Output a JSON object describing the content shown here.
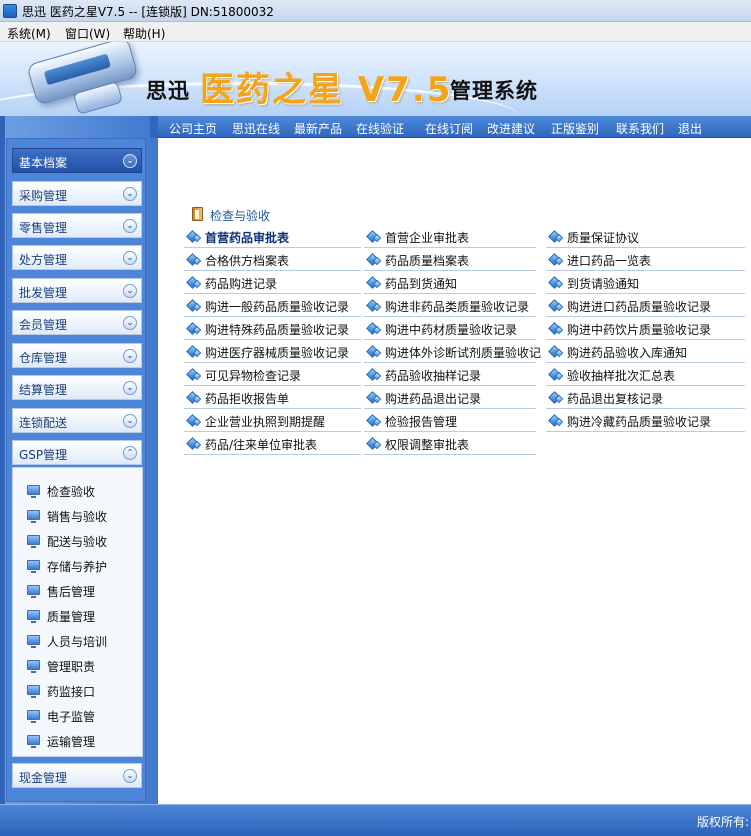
{
  "window": {
    "title": "思迅 医药之星V7.5 -- [连锁版] DN:51800032"
  },
  "menubar": {
    "items": [
      "系统(M)",
      "窗口(W)",
      "帮助(H)"
    ]
  },
  "banner": {
    "brand_prefix": "思迅",
    "brand_name": "医药之星 V7.5",
    "brand_suffix": "管理系统"
  },
  "topnav": {
    "items": [
      "公司主页",
      "思迅在线",
      "最新产品",
      "在线验证",
      "在线订阅",
      "改进建议",
      "正版鉴别",
      "联系我们",
      "退出"
    ]
  },
  "sidebar": {
    "categories": [
      "基本档案",
      "采购管理",
      "零售管理",
      "处方管理",
      "批发管理",
      "会员管理",
      "仓库管理",
      "结算管理",
      "连锁配送",
      "GSP管理",
      "现金管理"
    ],
    "active_category": "基本档案",
    "expanded_category": "GSP管理",
    "gsp_items": [
      "检查验收",
      "销售与验收",
      "配送与验收",
      "存储与养护",
      "售后管理",
      "质量管理",
      "人员与培训",
      "管理职责",
      "药监接口",
      "电子监管",
      "运输管理"
    ]
  },
  "main": {
    "section_title": "检查与验收",
    "links": [
      [
        "首营药品审批表",
        "首营企业审批表",
        "质量保证协议"
      ],
      [
        "合格供方档案表",
        "药品质量档案表",
        "进口药品一览表"
      ],
      [
        "药品购进记录",
        "药品到货通知",
        "到货请验通知"
      ],
      [
        "购进一般药品质量验收记录",
        "购进非药品类质量验收记录",
        "购进进口药品质量验收记录"
      ],
      [
        "购进特殊药品质量验收记录",
        "购进中药材质量验收记录",
        "购进中药饮片质量验收记录"
      ],
      [
        "购进医疗器械质量验收记录",
        "购进体外诊断试剂质量验收记",
        "购进药品验收入库通知"
      ],
      [
        "可见异物检查记录",
        "药品验收抽样记录",
        "验收抽样批次汇总表"
      ],
      [
        "药品拒收报告单",
        "购进药品退出记录",
        "药品退出复核记录"
      ],
      [
        "企业营业执照到期提醒",
        "检验报告管理",
        "购进冷藏药品质量验收记录"
      ],
      [
        "药品/往来单位审批表",
        "权限调整审批表"
      ]
    ]
  },
  "statusbar": {
    "copyright": "版权所有:"
  },
  "colors": {
    "accent_blue": "#2f67bf",
    "brand_orange": "#f6a316",
    "link_bold": "#0c2f7a"
  }
}
